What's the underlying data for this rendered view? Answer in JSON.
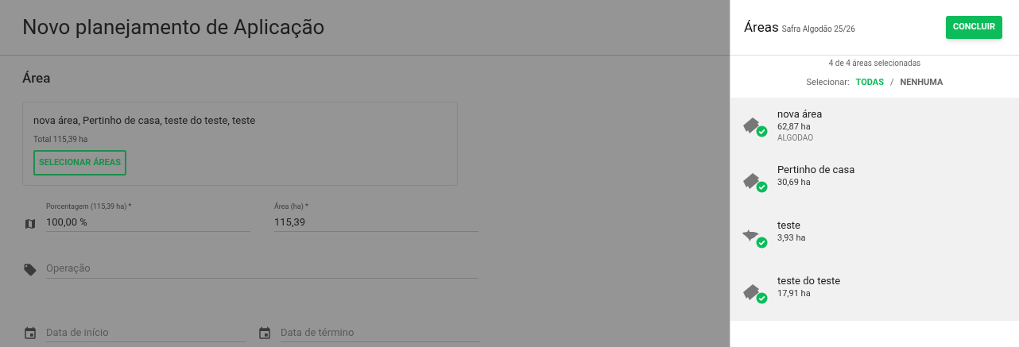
{
  "page": {
    "title": "Novo planejamento de Aplicação"
  },
  "area_section": {
    "heading": "Área",
    "selected_names": "nova área, Pertinho de casa, teste do teste, teste",
    "total": "Total 115,39 ha",
    "button": "SELECIONAR ÁREAS"
  },
  "fields": [
    {
      "kind": "map",
      "label": "Porcentagem (115,39 ha) *",
      "value": "100,00 %"
    },
    {
      "kind": "plain",
      "label": "Área (ha) *",
      "value": "115,39"
    },
    {
      "kind": "tag",
      "placeholder": "Operação"
    },
    {
      "kind": "date",
      "placeholder": "Data de início"
    },
    {
      "kind": "date",
      "placeholder": "Data de término"
    }
  ],
  "panel": {
    "title": "Áreas",
    "subtitle": "Safra Algodão 25/26",
    "done_button": "CONCLUIR",
    "count": "4 de 4 áreas selecionadas",
    "select_label": "Selecionar:",
    "select_options": [
      {
        "label": "TODAS",
        "selected": true
      },
      {
        "label": "NENHUMA",
        "selected": false
      }
    ],
    "separator": "/",
    "areas": [
      {
        "kind": "rect",
        "name": "nova área",
        "area": "62,87 ha",
        "crop": "ALGODAO",
        "selected": true
      },
      {
        "kind": "rect",
        "name": "Pertinho de casa",
        "area": "30,69 ha",
        "selected": true
      },
      {
        "kind": "blob",
        "name": "teste",
        "area": "3,93 ha",
        "selected": true
      },
      {
        "kind": "rect",
        "name": "teste do teste",
        "area": "17,91 ha",
        "selected": true
      }
    ]
  }
}
